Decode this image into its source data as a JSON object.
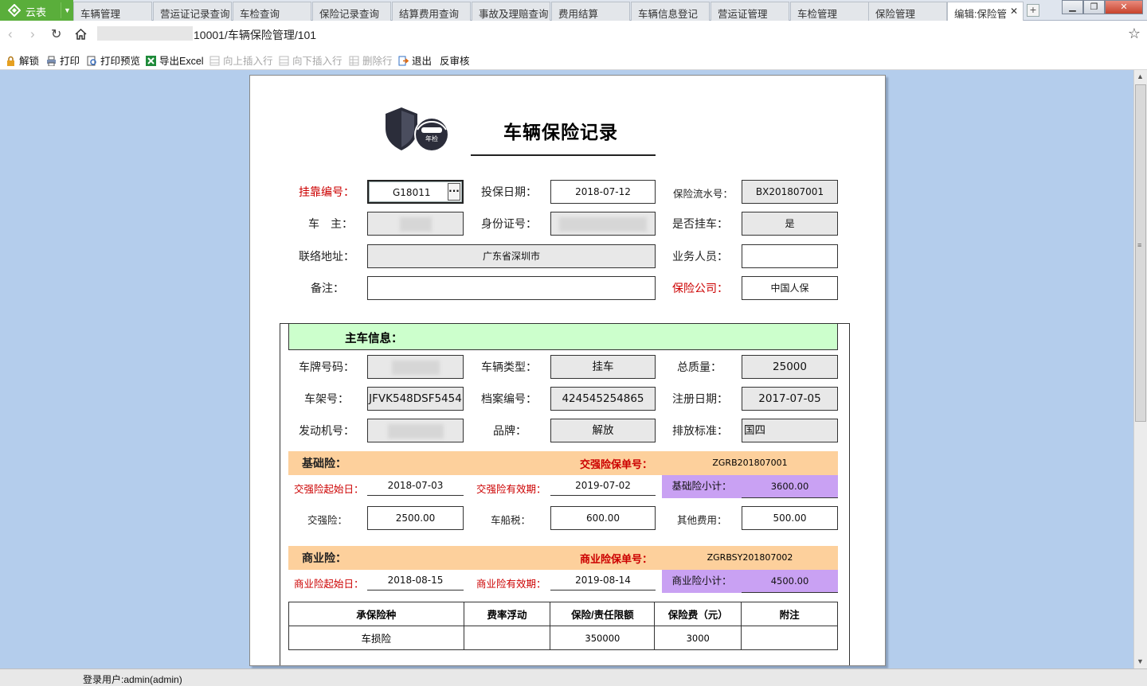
{
  "app": {
    "name": "云表",
    "brand_color": "#5aae3b"
  },
  "tabs": [
    {
      "label": "车辆管理",
      "active": false
    },
    {
      "label": "营运证记录查询",
      "active": false
    },
    {
      "label": "车检查询",
      "active": false
    },
    {
      "label": "保险记录查询",
      "active": false
    },
    {
      "label": "结算费用查询",
      "active": false
    },
    {
      "label": "事故及理赔查询",
      "active": false
    },
    {
      "label": "费用结算",
      "active": false
    },
    {
      "label": "车辆信息登记",
      "active": false
    },
    {
      "label": "营运证管理",
      "active": false
    },
    {
      "label": "车检管理",
      "active": false
    },
    {
      "label": "保险管理",
      "active": false
    },
    {
      "label": "编辑:保险管",
      "active": true
    }
  ],
  "address": {
    "path": "10001/车辆保险管理/101"
  },
  "toolbar": [
    {
      "label": "解锁",
      "icon": "lock-icon",
      "enabled": true
    },
    {
      "label": "打印",
      "icon": "printer-icon",
      "enabled": true
    },
    {
      "label": "打印预览",
      "icon": "print-preview-icon",
      "enabled": true
    },
    {
      "label": "导出Excel",
      "icon": "excel-icon",
      "enabled": true
    },
    {
      "label": "向上插入行",
      "icon": "insert-row-above-icon",
      "enabled": false
    },
    {
      "label": "向下插入行",
      "icon": "insert-row-below-icon",
      "enabled": false
    },
    {
      "label": "删除行",
      "icon": "delete-row-icon",
      "enabled": false
    },
    {
      "label": "退出",
      "icon": "exit-icon",
      "enabled": true
    },
    {
      "label": "反审核",
      "icon": "",
      "enabled": true
    }
  ],
  "form": {
    "title": "车辆保险记录",
    "logo_badge": "年检",
    "fields": {
      "affiliation_no": {
        "label": "挂靠编号：",
        "value": "G18011",
        "lookup": "···"
      },
      "insure_date": {
        "label": "投保日期：",
        "value": "2018-07-12"
      },
      "serial_no": {
        "label": "保险流水号：",
        "value": "BX201807001"
      },
      "owner": {
        "label": "车　主：",
        "value": ""
      },
      "id_no": {
        "label": "身份证号：",
        "value": ""
      },
      "is_affiliated": {
        "label": "是否挂车：",
        "value": "是"
      },
      "address": {
        "label": "联络地址：",
        "value": "广东省深圳市"
      },
      "salesperson": {
        "label": "业务人员：",
        "value": ""
      },
      "remarks": {
        "label": "备注：",
        "value": ""
      },
      "insurer": {
        "label": "保险公司：",
        "value": "中国人保"
      }
    },
    "main_vehicle": {
      "header": "主车信息：",
      "plate": {
        "label": "车牌号码：",
        "value": ""
      },
      "vehicle_type": {
        "label": "车辆类型：",
        "value": "挂车"
      },
      "total_mass": {
        "label": "总质量：",
        "value": "25000"
      },
      "frame_no": {
        "label": "车架号：",
        "value": "JFVK548DSF5454"
      },
      "file_no": {
        "label": "档案编号：",
        "value": "424545254865"
      },
      "reg_date": {
        "label": "注册日期：",
        "value": "2017-07-05"
      },
      "engine_no": {
        "label": "发动机号：",
        "value": ""
      },
      "brand": {
        "label": "品牌：",
        "value": "解放"
      },
      "emission": {
        "label": "排放标准：",
        "value": "国四"
      }
    },
    "basic": {
      "header": "基础险：",
      "policy_label": "交强险保单号：",
      "policy_no": "ZGRB201807001",
      "start_label": "交强险起始日：",
      "start": "2018-07-03",
      "end_label": "交强险有效期：",
      "end": "2019-07-02",
      "subtotal_label": "基础险小计：",
      "subtotal": "3600.00",
      "ctpl_label": "交强险：",
      "ctpl": "2500.00",
      "tax_label": "车船税：",
      "tax": "600.00",
      "other_label": "其他费用：",
      "other": "500.00"
    },
    "commercial": {
      "header": "商业险：",
      "policy_label": "商业险保单号：",
      "policy_no": "ZGRBSY201807002",
      "start_label": "商业险起始日：",
      "start": "2018-08-15",
      "end_label": "商业险有效期：",
      "end": "2019-08-14",
      "subtotal_label": "商业险小计：",
      "subtotal": "4500.00"
    },
    "coverage": {
      "headers": [
        "承保险种",
        "费率浮动",
        "保险/责任限额",
        "保险费（元）",
        "附注"
      ],
      "rows": [
        [
          "车损险",
          "",
          "350000",
          "3000",
          ""
        ]
      ]
    }
  },
  "status": {
    "user": "登录用户:admin(admin)"
  },
  "colors": {
    "page_bg": "#b4cdec",
    "green_header": "#ccffcc",
    "orange_band": "#fdd09c",
    "purple_cell": "#c9a1f3",
    "required_red": "#cc0000"
  }
}
